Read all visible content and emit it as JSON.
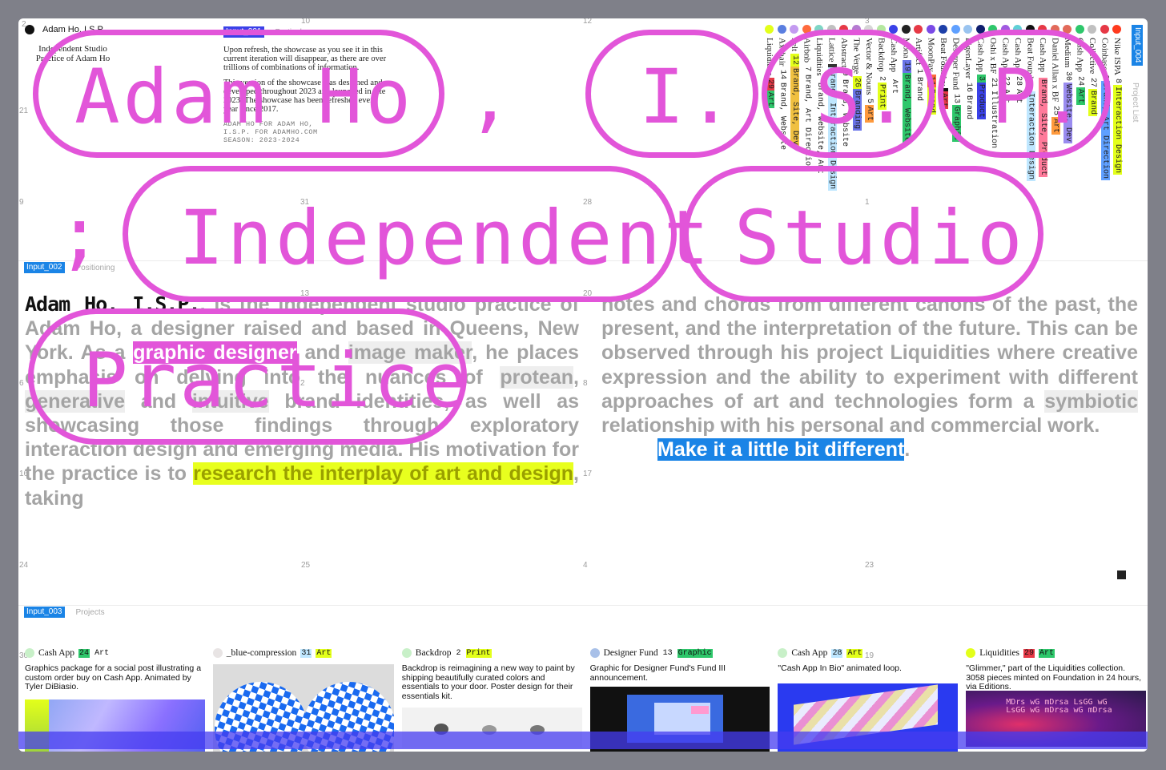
{
  "header": {
    "brand_name": "Adam Ho, I.S.P.",
    "brand_subtitle_1": "Independent Studio",
    "brand_subtitle_2": "Practice of Adam Ho"
  },
  "particulars": {
    "tag": "Input_001",
    "label": "Particulars",
    "p1": "Upon refresh, the showcase as you see it in this current iteration will disappear, as there are over trillions of combinations of information.",
    "p2": "This version of the showcase was designed and developed throughout 2023 and launched in late 2023. The showcase has been refreshed every year since 2017.",
    "mono1": "ADAM HO FOR ADAM HO,",
    "mono2": "I.S.P. FOR ADAMHO.COM",
    "mono3": "SEASON: 2023-2024"
  },
  "overlay_title": {
    "w1": "Adam Ho",
    "w2": ",",
    "w3": "I.",
    "w4": "S.",
    "w5": "P.",
    "w6": ";",
    "w7": "Independent",
    "w8": "Studio",
    "w9": "Practice"
  },
  "grid_numbers": [
    "2",
    "10",
    "12",
    "3",
    "21",
    "9",
    "31",
    "28",
    "1",
    "13",
    "20",
    "6",
    "2",
    "8",
    "16",
    "17",
    "24",
    "25",
    "4",
    "23",
    "30",
    "19"
  ],
  "project_list": {
    "tag": "Input_004",
    "label": "Project List",
    "items": [
      {
        "name": "Liquidities ",
        "num": "29",
        "cat": "Art",
        "dot": "#e3ff1a",
        "numbg": "#e63946",
        "catbg": "#2ec76b"
      },
      {
        "name": "Axehair ",
        "num": "14",
        "cat": "Brand, Website",
        "dot": "#5a7ee0",
        "numbg": "#ffffff",
        "catbg": "#ffffff"
      },
      {
        "name": "Felt ",
        "num": "12",
        "cat": "Brand, Site, Dev",
        "dot": "#c39af0",
        "numbg": "#e3ff1a",
        "catbg": "#f0c040"
      },
      {
        "name": "Airbnb ",
        "num": "7",
        "cat": "Brand, Art Direction",
        "dot": "#ff6a3d",
        "numbg": "#ffffff",
        "catbg": "#ffffff"
      },
      {
        "name": "Liquidities ",
        "num": "",
        "cat": "Brand, Website, Art",
        "dot": "#7fd6c5",
        "numbg": "#ffffff",
        "catbg": "#ffffff"
      },
      {
        "name": "Lattice ",
        "num": "",
        "cat": "Brand, Interaction Design",
        "dot": "#c0c0c0",
        "numbg": "#333",
        "catbg": "#bfe7ff"
      },
      {
        "name": "Abstract ",
        "num": "9",
        "cat": "Brand, Website",
        "dot": "#e63946",
        "numbg": "#ffffff",
        "catbg": "#ffffff"
      },
      {
        "name": "The Verge ",
        "num": "26",
        "cat": "Branding",
        "dot": "#b57bd1",
        "numbg": "#e3ff1a",
        "catbg": "#6a74e8"
      },
      {
        "name": "Vector & Nouns ",
        "num": "5",
        "cat": "Art",
        "dot": "#d6d6d6",
        "numbg": "#ffffff",
        "catbg": "#ff9a3d"
      },
      {
        "name": "Backdrop ",
        "num": "2",
        "cat": "Print",
        "dot": "#b5e8a0",
        "numbg": "#ffffff",
        "catbg": "#e3ff1a"
      },
      {
        "name": "Cash App ",
        "num": "",
        "cat": "Art",
        "dot": "#3a41e8",
        "numbg": "#ffffff",
        "catbg": "#ffffff"
      },
      {
        "name": "Mona ",
        "num": "19",
        "cat": "Brand, Website",
        "dot": "#222",
        "numbg": "#6a74e8",
        "catbg": "#2ec76b"
      },
      {
        "name": "Artifact ",
        "num": "1",
        "cat": "Brand",
        "dot": "#e63946",
        "numbg": "#ffffff",
        "catbg": "#ffffff"
      },
      {
        "name": "MoonPay ",
        "num": "11",
        "cat": "Brand",
        "dot": "#7a4ae6",
        "numbg": "#ff6a3d",
        "catbg": "#e3ff1a"
      },
      {
        "name": "Beat Foundry ",
        "num": "",
        "cat": "Art",
        "dot": "#1d3fa8",
        "numbg": "#111",
        "catbg": "#e63946"
      },
      {
        "name": "Designer Fund ",
        "num": "13",
        "cat": "Graphic",
        "dot": "#5fa0ff",
        "numbg": "#ffffff",
        "catbg": "#2ec76b"
      },
      {
        "name": "EigenLayer ",
        "num": "16",
        "cat": "Brand",
        "dot": "#9ac4f0",
        "numbg": "#ffffff",
        "catbg": "#ffffff"
      },
      {
        "name": "Cash App ",
        "num": "3",
        "cat": "Product",
        "dot": "#0f1e6e",
        "numbg": "#2ec76b",
        "catbg": "#3a41e8"
      },
      {
        "name": "Oshi x BF ",
        "num": "21",
        "cat": "Illustration",
        "dot": "#2ec76b",
        "numbg": "#ffffff",
        "catbg": "#ffffff"
      },
      {
        "name": "Cash App ",
        "num": "22",
        "cat": "Art",
        "dot": "#a05ae0",
        "numbg": "#ffffff",
        "catbg": "#ffffff"
      },
      {
        "name": "Cash App ",
        "num": "28",
        "cat": "Art",
        "dot": "#5fd0d6",
        "numbg": "#ffffff",
        "catbg": "#ffffff"
      },
      {
        "name": "Beat Foundry ",
        "num": "",
        "cat": "Interaction Design",
        "dot": "#111",
        "numbg": "#ffffff",
        "catbg": "#bfe7ff"
      },
      {
        "name": "Cash App ",
        "num": "",
        "cat": "Brand, Site, Product",
        "dot": "#e63946",
        "numbg": "#ffffff",
        "catbg": "#ff7a9a"
      },
      {
        "name": "Daniel Allan x BF ",
        "num": "25",
        "cat": "Art",
        "dot": "#e26a5a",
        "numbg": "#ffffff",
        "catbg": "#ff9a3d"
      },
      {
        "name": "Medium ",
        "num": "30",
        "cat": "Website, Dev",
        "dot": "#e26a5a",
        "numbg": "#ffffff",
        "catbg": "#9a8cf0"
      },
      {
        "name": "Cash App ",
        "num": "24",
        "cat": "Art",
        "dot": "#2ec76b",
        "numbg": "#ffffff",
        "catbg": "#2ec76b"
      },
      {
        "name": "Collective ",
        "num": "27",
        "cat": "Brand",
        "dot": "#c0c0c0",
        "numbg": "#ffffff",
        "catbg": "#e3ff1a"
      },
      {
        "name": "Coinbase ",
        "num": "6",
        "cat": "Brand, Art Direction",
        "dot": "#e63946",
        "numbg": "#ffffff",
        "catbg": "#5fa0ff"
      },
      {
        "name": "Nike ISPA ",
        "num": "8",
        "cat": "Interaction Design",
        "dot": "#ff3a1e",
        "numbg": "#ffffff",
        "catbg": "#e3ff1a"
      }
    ]
  },
  "positioning": {
    "tag": "Input_002",
    "label": "Positioning",
    "lead": "Adam Ho, I.S.P.",
    "t1": ", is the independent studio practice of Adam Ho, a designer raised and based in Queens, New York. As a ",
    "h1": "graphic designer",
    "t2": " and ",
    "h2": "image maker",
    "t3": ", he places emphasis on delving into the nuances of ",
    "h3": "protean",
    "t4": ", ",
    "h4": "generative",
    "t5": " and ",
    "h5": "intuitive",
    "t6": " brand identities, as well as showcasing those findings through exploratory interaction design and emerging media. His motivation for the practice is to ",
    "h6": "research the interplay of art and design",
    "t7": ", taking",
    "r1": "notes and chords from different canons of the past, the present, and the interpretation of the future. This can be observed through his project Liquidities where creative expression and the ability to experiment with different approaches of art and technologies form a ",
    "rh1": "symbiotic",
    "r2": " relationship with his personal and commercial work.",
    "motto": "Make it a little bit different",
    "motto_end": "."
  },
  "projects": {
    "tag": "Input_003",
    "label": "Projects",
    "cards": [
      {
        "name": "Cash App ",
        "num": "24",
        "cat": "Art",
        "dot": "#c8f0c8",
        "numbg": "#2ec76b",
        "catbg": "#ffffff",
        "desc": "Graphics package for a social post illustrating a custom order buy on Cash App. Animated by Tyler DiBiasio."
      },
      {
        "name": "_blue-compression ",
        "num": "31",
        "cat": "Art",
        "dot": "#e8e4e4",
        "numbg": "#bfe7ff",
        "catbg": "#e3ff1a",
        "desc": ""
      },
      {
        "name": "Backdrop ",
        "num": "2",
        "cat": "Print",
        "dot": "#c8f0c8",
        "numbg": "#ffffff",
        "catbg": "#e3ff1a",
        "desc": "Backdrop is reimagining a new way to paint by shipping beautifully curated colors and essentials to your door. Poster design for their essentials kit."
      },
      {
        "name": "Designer Fund ",
        "num": "13",
        "cat": "Graphic",
        "dot": "#a8c0e8",
        "numbg": "#ffffff",
        "catbg": "#2ec76b",
        "desc": "Graphic for Designer Fund's Fund III announcement."
      },
      {
        "name": "Cash App ",
        "num": "28",
        "cat": "Art",
        "dot": "#c8f0c8",
        "numbg": "#bfe7ff",
        "catbg": "#e3ff1a",
        "desc": "\"Cash App In Bio\" animated loop."
      },
      {
        "name": "Liquidities ",
        "num": "29",
        "cat": "Art",
        "dot": "#e3ff1a",
        "numbg": "#e63946",
        "catbg": "#2ec76b",
        "desc": "\"Glimmer,\" part of the Liquidities collection. 3058 pieces minted on Foundation in 24 hours, via Editions."
      }
    ]
  },
  "colors": {
    "accent_pink": "#e255d9",
    "accent_blue": "#1a84e6",
    "accent_yellow": "#e8ff1e"
  }
}
